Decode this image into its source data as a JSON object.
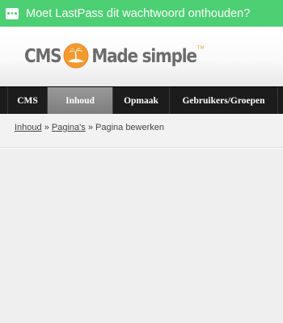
{
  "lastpass_bar": {
    "text": "Moet LastPass dit wachtwoord onthouden?",
    "icon": "lastpass-dots-icon",
    "color": "#4dcf73"
  },
  "logo": {
    "text_left": "CMS",
    "text_right": "Made simple",
    "trademark": "TM"
  },
  "nav": {
    "items": [
      {
        "label": "CMS",
        "active": false
      },
      {
        "label": "Inhoud",
        "active": true
      },
      {
        "label": "Opmaak",
        "active": false
      },
      {
        "label": "Gebruikers/Groepen",
        "active": false
      }
    ]
  },
  "breadcrumb": {
    "items": [
      "Inhoud",
      "Pagina's"
    ],
    "current": "Pagina bewerken",
    "separator": "»"
  }
}
